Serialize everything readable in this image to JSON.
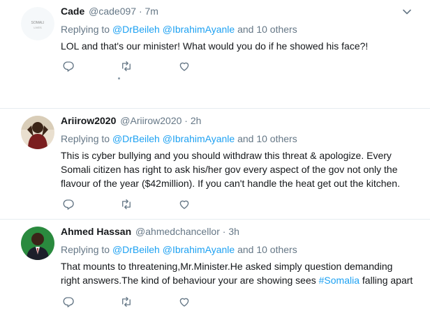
{
  "tweets": [
    {
      "name": "Cade",
      "handle": "@cade097",
      "time": "7m",
      "avatar_text_top": "SOMALI",
      "avatar_text_bottom": "LIVES",
      "reply_prefix": "Replying to",
      "mention1": "@DrBeileh",
      "mention2": "@IbrahimAyanle",
      "reply_suffix": "and 10 others",
      "text": "LOL and that's our minister! What would you do if he showed his face?!"
    },
    {
      "name": "Ariirow2020",
      "handle": "@Ariirow2020",
      "time": "2h",
      "reply_prefix": "Replying to",
      "mention1": "@DrBeileh",
      "mention2": "@IbrahimAyanle",
      "reply_suffix": "and 10 others",
      "text": "This is cyber bullying and you should withdraw this threat & apologize. Every Somali citizen has right to ask his/her gov every aspect of the gov not only the flavour of the year ($42million). If you can't handle the heat get out the kitchen."
    },
    {
      "name": "Ahmed Hassan",
      "handle": "@ahmedchancellor",
      "time": "3h",
      "reply_prefix": "Replying to",
      "mention1": "@DrBeileh",
      "mention2": "@IbrahimAyanle",
      "reply_suffix": "and 10 others",
      "text_before_hashtag": "That mounts to threatening,Mr.Minister.He asked simply question demanding right answers.The kind of behaviour your are showing sees ",
      "hashtag": "#Somalia",
      "text_after_hashtag": " falling apart"
    }
  ],
  "separator": "·",
  "icons": [
    "reply-icon",
    "retweet-icon",
    "like-icon",
    "caret-down-icon"
  ],
  "colors": {
    "link": "#1da1f2",
    "secondary": "#657786",
    "icon": "#657786",
    "border": "#e6ecf0"
  }
}
